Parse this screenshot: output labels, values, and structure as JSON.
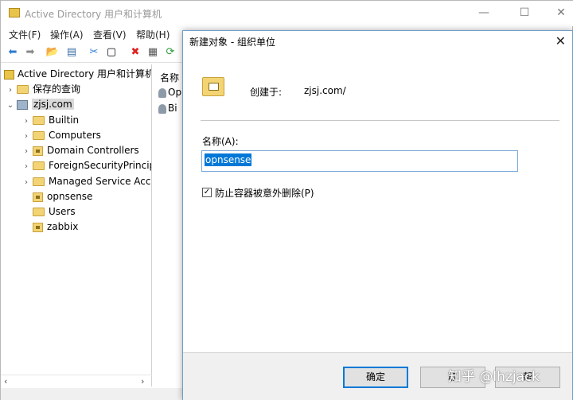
{
  "window": {
    "title": "Active Directory 用户和计算机",
    "controls": {
      "minimize": "—",
      "maximize": "☐",
      "close": "✕"
    }
  },
  "menu": {
    "items": [
      "文件(F)",
      "操作(A)",
      "查看(V)",
      "帮助(H)"
    ]
  },
  "toolbar": {
    "icons": [
      "back-arrow-icon",
      "forward-arrow-icon",
      "up-folder-icon",
      "show-pane-icon",
      "cut-icon",
      "copy-icon",
      "delete-icon",
      "properties-icon",
      "refresh-icon"
    ],
    "glyphs": [
      "⬅",
      "➡",
      "📂",
      "▤",
      "✂",
      "▢",
      "✖",
      "▦",
      "⟳"
    ]
  },
  "tree": {
    "root": "Active Directory 用户和计算机",
    "saved_queries": "保存的查询",
    "domain": "zjsj.com",
    "children": [
      "Builtin",
      "Computers",
      "Domain Controllers",
      "ForeignSecurityPrincipa",
      "Managed Service Acco",
      "opnsense",
      "Users",
      "zabbix"
    ],
    "expand_collapsed": "›",
    "expand_open": "⌄"
  },
  "list": {
    "header": "名称",
    "rows": [
      "Op",
      "Bi"
    ]
  },
  "scrollbar": {
    "left": "‹",
    "right": "›"
  },
  "dialog": {
    "title": "新建对象 - 组织单位",
    "close": "✕",
    "created_in_label": "创建于:",
    "created_in_value": "zjsj.com/",
    "name_label": "名称(A):",
    "name_value": "opnsense",
    "protect_label": "防止容器被意外删除(P)",
    "protect_checked": "✓",
    "buttons": {
      "ok": "确定",
      "cancel": "取",
      "help": "帮"
    }
  },
  "watermark": "知乎 @lhzjack",
  "colors": {
    "accent": "#0078d7",
    "folder": "#f3d475"
  }
}
